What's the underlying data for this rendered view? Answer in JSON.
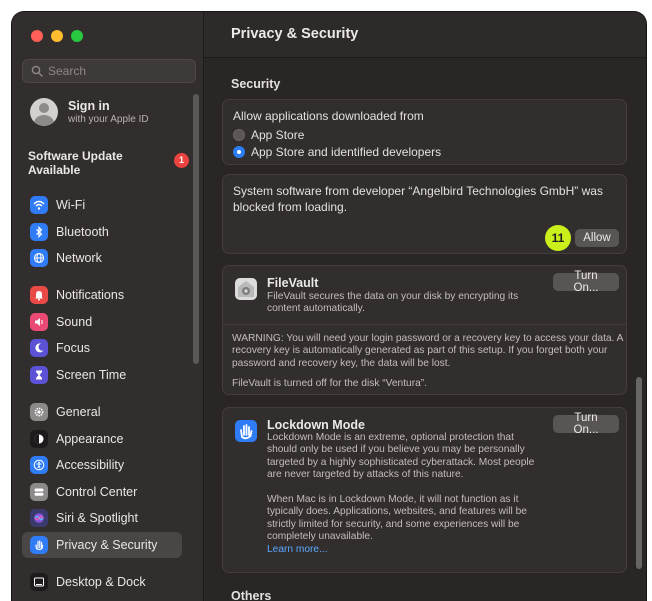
{
  "window": {
    "title": "Privacy & Security"
  },
  "search": {
    "placeholder": "Search"
  },
  "account": {
    "name": "Sign in",
    "subtitle": "with your Apple ID"
  },
  "software_update": {
    "label": "Software Update Available",
    "badge": "1"
  },
  "sidebar": {
    "group1": [
      {
        "label": "Wi-Fi",
        "icon": "wifi-icon",
        "color": "#2f7cf6"
      },
      {
        "label": "Bluetooth",
        "icon": "bluetooth-icon",
        "color": "#2f7cf6"
      },
      {
        "label": "Network",
        "icon": "globe-icon",
        "color": "#2f7cf6"
      }
    ],
    "group2": [
      {
        "label": "Notifications",
        "icon": "bell-icon",
        "color": "#ea4a45"
      },
      {
        "label": "Sound",
        "icon": "speaker-icon",
        "color": "#ea4a73"
      },
      {
        "label": "Focus",
        "icon": "moon-icon",
        "color": "#5b52d6"
      },
      {
        "label": "Screen Time",
        "icon": "hourglass-icon",
        "color": "#5b52d6"
      }
    ],
    "group3": [
      {
        "label": "General",
        "icon": "gear-icon",
        "color": "#8e8a8a"
      },
      {
        "label": "Appearance",
        "icon": "appearance-icon",
        "color": "#1d1b1b"
      },
      {
        "label": "Accessibility",
        "icon": "accessibility-icon",
        "color": "#2f7cf6"
      },
      {
        "label": "Control Center",
        "icon": "control-center-icon",
        "color": "#8e8a8a"
      },
      {
        "label": "Siri & Spotlight",
        "icon": "siri-icon",
        "color": "#3b3a6e"
      },
      {
        "label": "Privacy & Security",
        "icon": "hand-icon",
        "color": "#2f7cf6",
        "active": true
      }
    ],
    "group4": [
      {
        "label": "Desktop & Dock",
        "icon": "dock-icon",
        "color": "#1d1b1b"
      }
    ]
  },
  "security": {
    "section_title": "Security",
    "allow_heading": "Allow applications downloaded from",
    "options": [
      "App Store",
      "App Store and identified developers"
    ],
    "selected": "App Store and identified developers",
    "blocked_message": "System software from developer “Angelbird Technologies GmbH” was blocked from loading.",
    "allow_button": "Allow",
    "step_badge": "11"
  },
  "filevault": {
    "title": "FileVault",
    "description": "FileVault secures the data on your disk by encrypting its content automatically.",
    "button": "Turn On...",
    "warning": "WARNING: You will need your login password or a recovery key to access your data. A recovery key is automatically generated as part of this setup. If you forget both your password and recovery key, the data will be lost.",
    "status": "FileVault is turned off for the disk “Ventura”."
  },
  "lockdown": {
    "title": "Lockdown Mode",
    "description": "Lockdown Mode is an extreme, optional protection that should only be used if you believe you may be personally targeted by a highly sophisticated cyberattack. Most people are never targeted by attacks of this nature.",
    "description2": "When Mac is in Lockdown Mode, it will not function as it typically does. Applications, websites, and features will be strictly limited for security, and some experiences will be completely unavailable.",
    "learn_more": "Learn more...",
    "button": "Turn On..."
  },
  "others": {
    "section_title": "Others"
  }
}
